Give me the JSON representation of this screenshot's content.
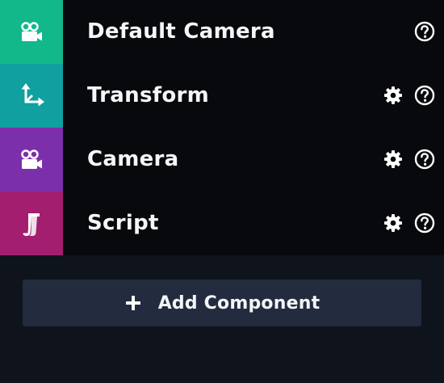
{
  "components": [
    {
      "label": "Default Camera",
      "icon": "camera-icon",
      "color": "#12b78a",
      "has_settings": false,
      "has_help": true
    },
    {
      "label": "Transform",
      "icon": "transform-axes-icon",
      "color": "#10a0a0",
      "has_settings": true,
      "has_help": true
    },
    {
      "label": "Camera",
      "icon": "camera-icon",
      "color": "#7c2fab",
      "has_settings": true,
      "has_help": true
    },
    {
      "label": "Script",
      "icon": "script-scroll-icon",
      "color": "#a31e6f",
      "has_settings": true,
      "has_help": true
    }
  ],
  "add_component": {
    "label": "Add Component",
    "icon": "plus-icon"
  },
  "colors": {
    "list_background": "#08090d",
    "panel_background": "#0f131b",
    "button_background": "#222c3e",
    "text": "#f5f6f8"
  }
}
